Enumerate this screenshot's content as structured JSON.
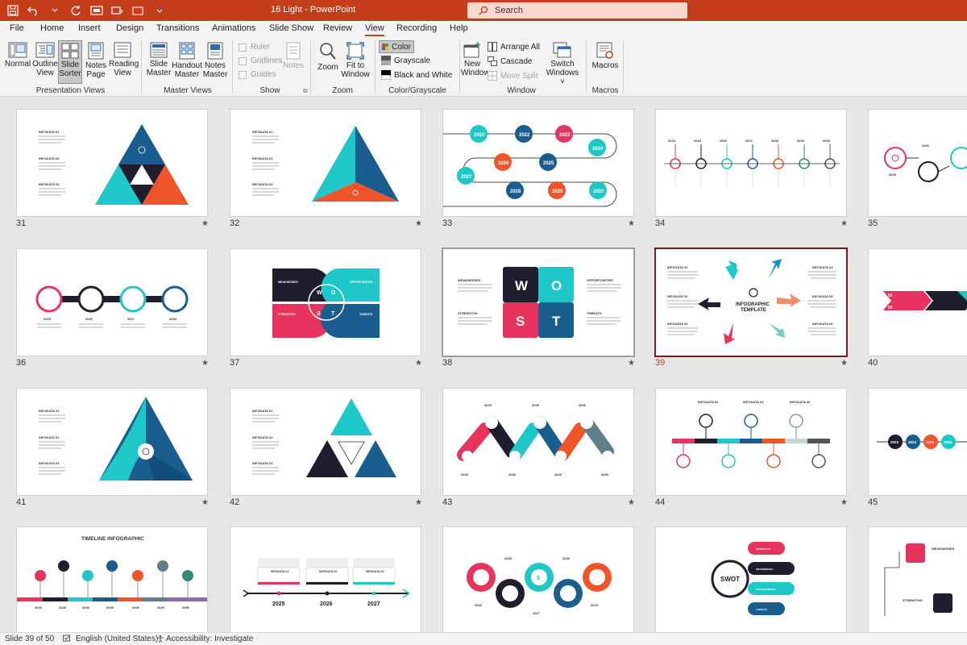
{
  "app": {
    "title": "16 Light  -  PowerPoint",
    "search_placeholder": "Search",
    "accent": "#c43e1c"
  },
  "tabs": [
    "File",
    "Home",
    "Insert",
    "Design",
    "Transitions",
    "Animations",
    "Slide Show",
    "Review",
    "View",
    "Recording",
    "Help"
  ],
  "active_tab": "View",
  "ribbon": {
    "presentation_views": {
      "label": "Presentation Views",
      "normal": "Normal",
      "outline": "Outline View",
      "sorter": "Slide Sorter",
      "notes_page": "Notes Page",
      "reading": "Reading View"
    },
    "master_views": {
      "label": "Master Views",
      "slide_master": "Slide Master",
      "handout_master": "Handout Master",
      "notes_master": "Notes Master"
    },
    "show": {
      "label": "Show",
      "ruler": "Ruler",
      "gridlines": "Gridlines",
      "guides": "Guides",
      "notes": "Notes"
    },
    "zoom": {
      "label": "Zoom",
      "zoom": "Zoom",
      "fit": "Fit to Window"
    },
    "color": {
      "label": "Color/Grayscale",
      "color": "Color",
      "grayscale": "Grayscale",
      "bw": "Black and White"
    },
    "window": {
      "label": "Window",
      "new_window": "New Window",
      "arrange_all": "Arrange All",
      "cascade": "Cascade",
      "move_split": "Move Split",
      "switch_windows": "Switch Windows"
    },
    "macros": {
      "label": "Macros",
      "macros": "Macros"
    }
  },
  "slides": [
    {
      "num": "31"
    },
    {
      "num": "32"
    },
    {
      "num": "33"
    },
    {
      "num": "34"
    },
    {
      "num": "35"
    },
    {
      "num": "36"
    },
    {
      "num": "37"
    },
    {
      "num": "38"
    },
    {
      "num": "39"
    },
    {
      "num": "40"
    },
    {
      "num": "41"
    },
    {
      "num": "42"
    },
    {
      "num": "43"
    },
    {
      "num": "44"
    },
    {
      "num": "45"
    }
  ],
  "slide_text": {
    "infodata_01": "INFODATA 01",
    "infodata_02": "INFODATA 02",
    "infodata_03": "INFODATA 03",
    "infodata_04": "INFODATA 04",
    "infodata_05": "INFODATA 05",
    "infodata_06": "INFODATA 06",
    "weaknesses": "WEAKNESSES",
    "opportunities": "OPPORTUNITIES",
    "strengths": "STRENGTHS",
    "threats": "THREATS",
    "infographic": "INFOGRAPHIC",
    "template": "TEMPLATE",
    "timeline_infographic": "TIMELINE INFOGRAPHIC",
    "swot": "SWOT",
    "w": "W",
    "o": "O",
    "s": "S",
    "t": "T",
    "years_33": [
      "2020",
      "2022",
      "2023",
      "2024",
      "2026",
      "2025",
      "2027",
      "2028",
      "2029",
      "2020"
    ],
    "years_34": [
      "2024",
      "2025",
      "2026",
      "2027",
      "2028",
      "2029",
      "2030"
    ],
    "years_35": [
      "2025",
      "2026"
    ],
    "years_36": [
      "2025",
      "2026",
      "2027",
      "2028"
    ],
    "years_43_top": [
      "2025",
      "2035",
      "2045"
    ],
    "years_43_bottom": [
      "2020",
      "2030",
      "2040",
      "2050"
    ],
    "years_45": [
      "2023",
      "2024",
      "2025",
      "2026"
    ],
    "years_46": [
      "2020",
      "2025",
      "2030",
      "2035",
      "2040",
      "2045",
      "2050"
    ],
    "years_47": [
      "2025",
      "2026",
      "2027"
    ],
    "years_48_top": [
      "2026",
      "2028"
    ],
    "years_48_bottom": [
      "2025",
      "2027",
      "2029"
    ],
    "nums_40": [
      "01",
      "02"
    ],
    "dollar": "$"
  },
  "status": {
    "slide_info": "Slide 39 of 50",
    "language": "English (United States)",
    "accessibility": "Accessibility: Investigate"
  }
}
